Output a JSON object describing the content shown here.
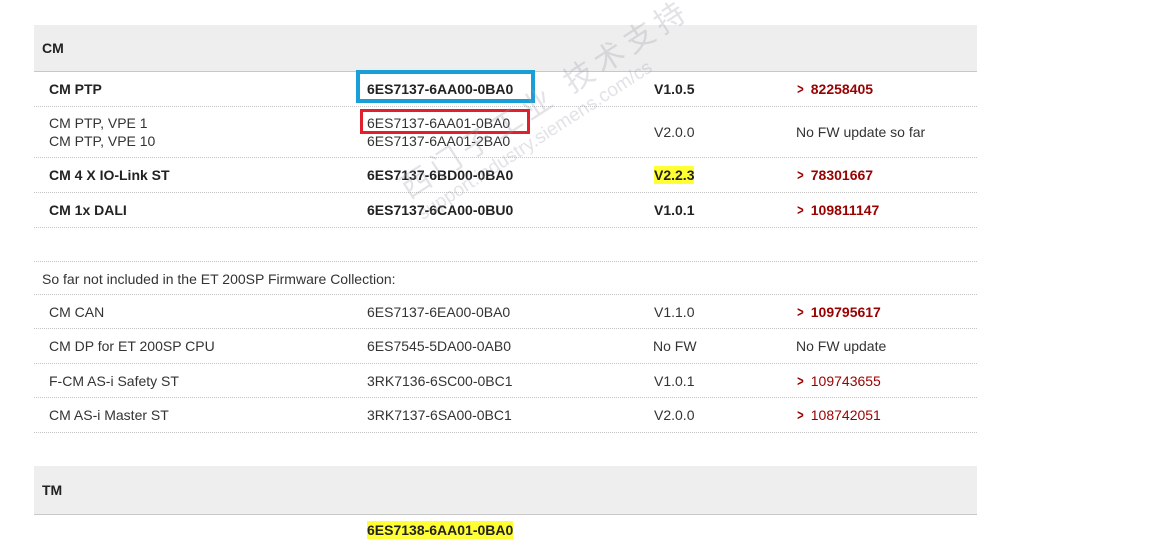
{
  "cm_section": {
    "title": "CM",
    "rows": [
      {
        "name": "CM PTP",
        "order": "6ES7137-6AA00-0BA0",
        "version": "V1.0.5",
        "link": "82258405",
        "bold": true
      },
      {
        "name1": "CM PTP, VPE 1",
        "name2": "CM PTP, VPE 10",
        "order1": "6ES7137-6AA01-0BA0",
        "order2": "6ES7137-6AA01-2BA0",
        "version": "V2.0.0",
        "note": "No FW update so far"
      },
      {
        "name": "CM 4 X IO-Link ST",
        "order": "6ES7137-6BD00-0BA0",
        "version": "V2.2.3",
        "link": "78301667",
        "bold": true
      },
      {
        "name": "CM 1x DALI",
        "order": "6ES7137-6CA00-0BU0",
        "version": "V1.0.1",
        "link": "109811147",
        "bold": true
      }
    ]
  },
  "note_text": "So far not included in the ET 200SP Firmware Collection:",
  "other_rows": [
    {
      "name": "CM CAN",
      "order": "6ES7137-6EA00-0BA0",
      "version": "V1.1.0",
      "link": "109795617",
      "link_bold": true
    },
    {
      "name": "CM DP for ET 200SP CPU",
      "order": "6ES7545-5DA00-0AB0",
      "version": "No FW",
      "note": "No FW update"
    },
    {
      "name": "F-CM AS-i Safety ST",
      "order": "3RK7136-6SC00-0BC1",
      "version": "V1.0.1",
      "link": "109743655"
    },
    {
      "name": "CM AS-i Master ST",
      "order": "3RK7137-6SA00-0BC1",
      "version": "V2.0.0",
      "link": "108742051"
    }
  ],
  "tm_section": {
    "title": "TM",
    "partial_order": "6ES7138-6AA01-0BA0"
  },
  "watermark": {
    "line1": "西门子工业 技术支持",
    "line2": "support.industry.siemens.com/cs"
  },
  "colors": {
    "link": "#990000",
    "highlight": "#ffff33",
    "box_blue": "#1a9ed8",
    "box_red": "#e0202c",
    "header_bg": "#eeeeee"
  }
}
